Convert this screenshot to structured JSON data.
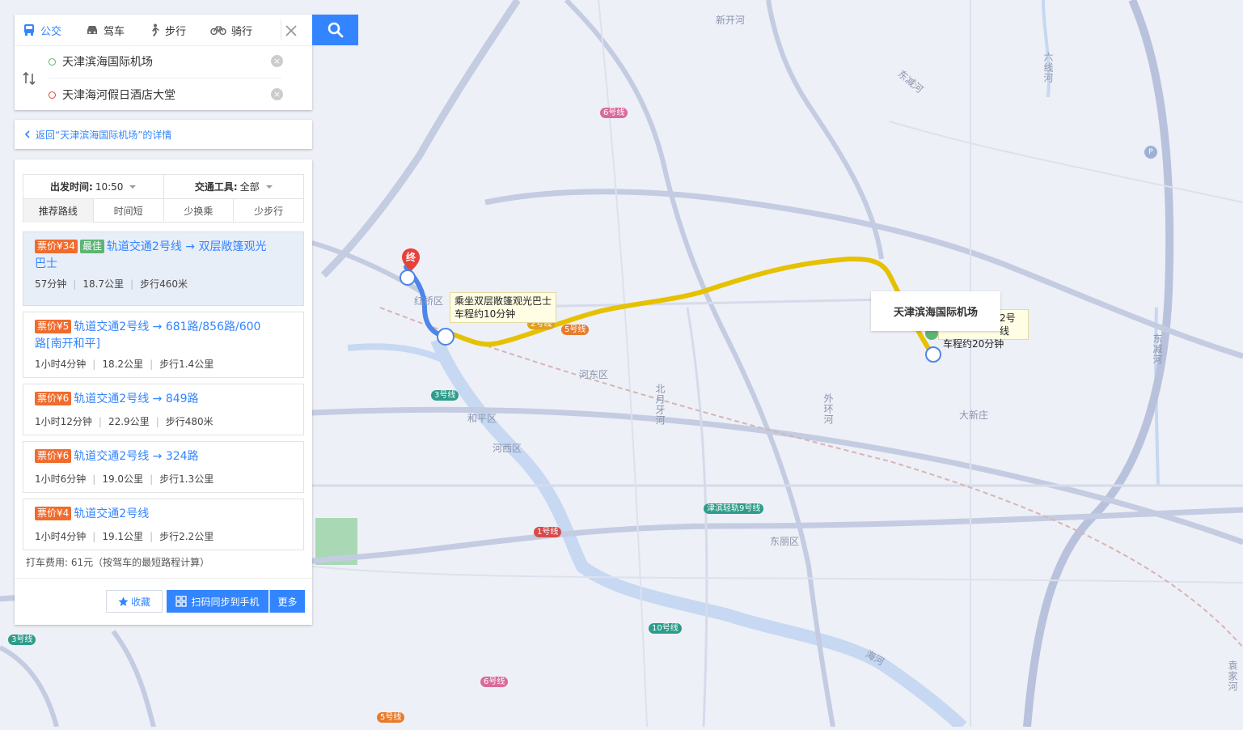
{
  "colors": {
    "accent": "#3385ff",
    "price": "#f06c2e",
    "best": "#5db574",
    "route_bus": "#e5c100",
    "route_metro": "#4d86e8",
    "map_bg": "#eef0f7"
  },
  "modes": [
    {
      "label": "公交",
      "icon": "bus-icon"
    },
    {
      "label": "驾车",
      "icon": "car-icon"
    },
    {
      "label": "步行",
      "icon": "walk-icon"
    },
    {
      "label": "骑行",
      "icon": "bike-icon"
    }
  ],
  "route": {
    "origin": "天津滨海国际机场",
    "destination": "天津海河假日酒店大堂"
  },
  "back": {
    "label": "返回“天津滨海国际机场”的详情"
  },
  "filters": {
    "depart_label": "出发时间:",
    "depart_value": "10:50",
    "transport_label": "交通工具:",
    "transport_value": "全部"
  },
  "tabs": [
    "推荐路线",
    "时间短",
    "少换乘",
    "少步行"
  ],
  "plans": [
    {
      "price": "票价¥34",
      "best": "最佳",
      "title": "轨道交通2号线 → 双层敞篷观光巴士",
      "duration": "57分钟",
      "distance": "18.7公里",
      "walk": "步行460米"
    },
    {
      "price": "票价¥5",
      "title": "轨道交通2号线 → 681路/856路/600路[南开和平]",
      "duration": "1小时4分钟",
      "distance": "18.2公里",
      "walk": "步行1.4公里"
    },
    {
      "price": "票价¥6",
      "title": "轨道交通2号线 → 849路",
      "duration": "1小时12分钟",
      "distance": "22.9公里",
      "walk": "步行480米"
    },
    {
      "price": "票价¥6",
      "title": "轨道交通2号线 → 324路",
      "duration": "1小时6分钟",
      "distance": "19.0公里",
      "walk": "步行1.3公里"
    },
    {
      "price": "票价¥4",
      "title": "轨道交通2号线",
      "duration": "1小时4分钟",
      "distance": "19.1公里",
      "walk": "步行2.2公里"
    }
  ],
  "taxi": "打车费用: 61元（按驾车的最短路程计算）",
  "footer": {
    "favorite": "收藏",
    "sync": "扫码同步到手机",
    "more": "更多"
  },
  "map": {
    "end_marker": "终",
    "tooltip1_line1": "乘坐双层敞篷观光巴士",
    "tooltip1_line2": "车程约10分钟",
    "tooltip2_line1": "2号线",
    "tooltip2_line2": "车程约20分钟",
    "airport": "天津滨海国际机场",
    "labels": {
      "xinkaihe": "新开河",
      "dongjianhe": "东减河",
      "liuxianhe": "六线河",
      "hedong": "河东区",
      "heping": "和平区",
      "hexi": "河西区",
      "hongqiao": "红桥区",
      "beiyunhe": "北月牙河",
      "waihuanhe": "外环河",
      "daxinzhuang": "大新庄",
      "dongli": "东丽区",
      "haihe": "海河",
      "dongjian2": "东减河",
      "yuanjiahe": "袁家河"
    },
    "badges": {
      "l6a": "6号线",
      "l2": "2号线",
      "l5": "5号线",
      "l3": "3号线",
      "l1": "1号线",
      "l9": "津滨轻轨9号线",
      "l10": "10号线",
      "l6b": "6号线",
      "l5b": "5号线",
      "l3b": "3号线"
    }
  }
}
